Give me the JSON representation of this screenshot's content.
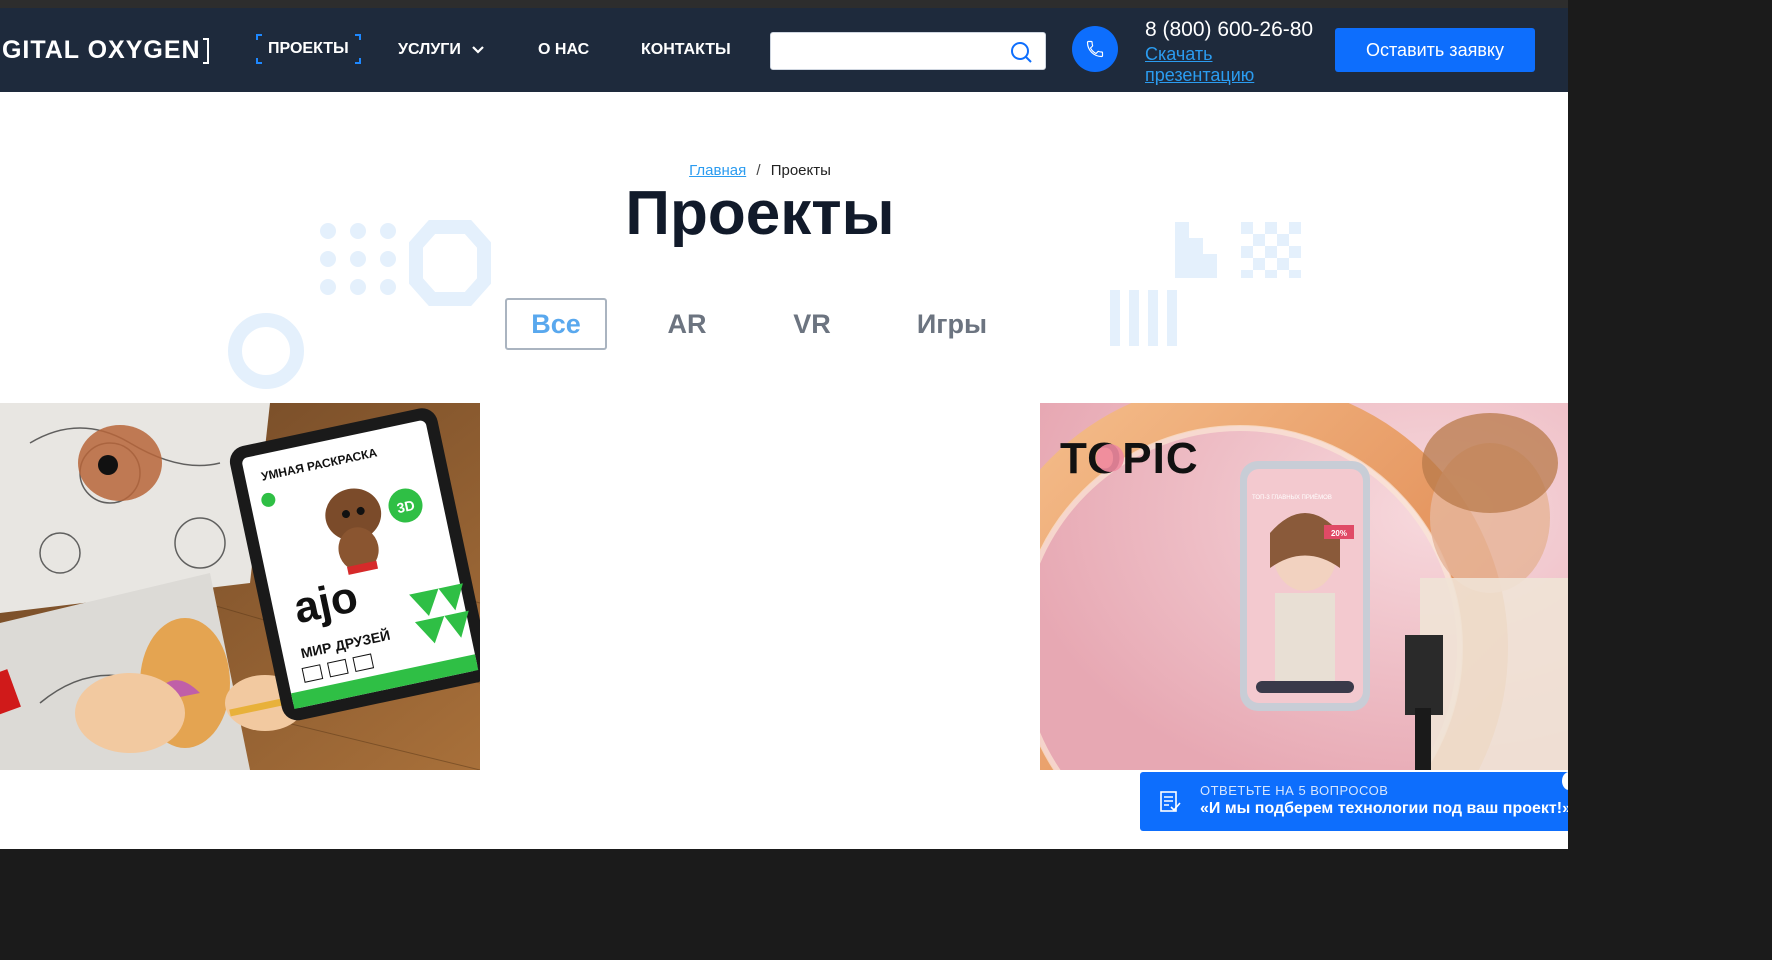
{
  "header": {
    "logo": "IGITAL OXYGEN",
    "nav": [
      {
        "label": "ПРОЕКТЫ"
      },
      {
        "label": "УСЛУГИ"
      },
      {
        "label": "О НАС"
      },
      {
        "label": "КОНТАКТЫ"
      }
    ],
    "search": {
      "value": "",
      "placeholder": ""
    },
    "phone": "8 (800) 600-26-80",
    "download_link": "Скачать презентацию",
    "cta": "Оставить заявку"
  },
  "breadcrumb": {
    "home": "Главная",
    "separator": "/",
    "current": "Проекты"
  },
  "page_title": "Проекты",
  "filters": [
    {
      "label": "Все",
      "active": true
    },
    {
      "label": "AR",
      "active": false
    },
    {
      "label": "VR",
      "active": false
    },
    {
      "label": "Игры",
      "active": false
    }
  ],
  "cards": {
    "left": {
      "headline": "УМНАЯ РАСКРАСКА",
      "brand": "ajo",
      "badge": "3D",
      "subtitle": "МИР ДРУЗЕЙ"
    },
    "right": {
      "brand": "TOPIC",
      "overlay_text": "ТОП-3 ГЛАВНЫХ ПРИЁМОВ",
      "discount": "20%"
    }
  },
  "quiz": {
    "line1": "ОТВЕТЬТЕ НА 5 ВОПРОСОВ",
    "line2": "«И мы подберем технологии под ваш проект!»"
  },
  "colors": {
    "header_bg": "#1e2a3c",
    "accent_blue": "#0d6efd",
    "link_blue": "#2b9cf0",
    "title_dark": "#111a2a",
    "deco_light": "#e4f0fc"
  },
  "icons": [
    "search-icon",
    "phone-icon",
    "chevron-down-icon",
    "form-icon"
  ]
}
